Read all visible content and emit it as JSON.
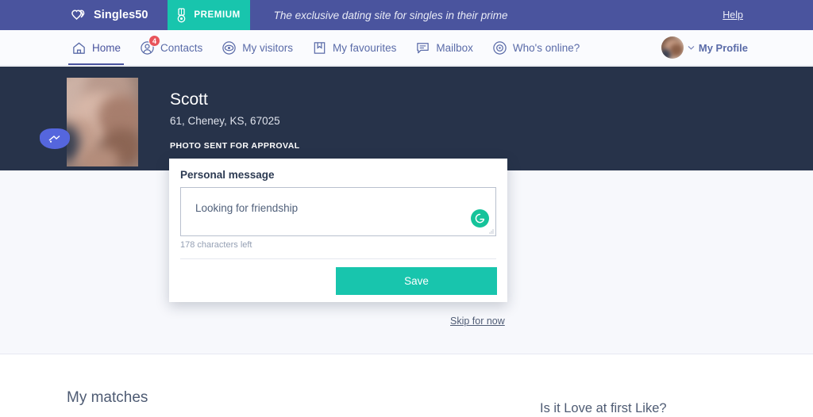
{
  "topbar": {
    "brand": "Singles50",
    "brand_logo_icon": "double-heart-icon",
    "premium_label": "PREMIUM",
    "premium_icon": "medal-icon",
    "tagline": "The exclusive dating site for singles in their prime",
    "help_label": "Help",
    "bg_color": "#4a549e",
    "premium_color": "#18c5ad"
  },
  "nav": {
    "items": [
      {
        "label": "Home",
        "icon": "home-icon",
        "active": true,
        "badge": ""
      },
      {
        "label": "Contacts",
        "icon": "person-circle-icon",
        "active": false,
        "badge": "4"
      },
      {
        "label": "My visitors",
        "icon": "eye-circle-icon",
        "active": false,
        "badge": ""
      },
      {
        "label": "My favourites",
        "icon": "bookmark-icon",
        "active": false,
        "badge": ""
      },
      {
        "label": "Mailbox",
        "icon": "speech-bubble-icon",
        "active": false,
        "badge": ""
      },
      {
        "label": "Who's online?",
        "icon": "target-circle-icon",
        "active": false,
        "badge": ""
      }
    ],
    "badge_color": "#e8545b",
    "profile": {
      "label": "My Profile",
      "avatar_icon": "user-avatar-photo",
      "chevron_icon": "chevron-down-icon"
    }
  },
  "hero": {
    "name": "Scott",
    "details": "61, Cheney, KS, 67025",
    "status": "PHOTO SENT FOR APPROVAL",
    "photo_icon": "profile-photo-thumbnail",
    "photo_badge_icon": "photo-pending-badge-icon",
    "bg_color": "#27334a"
  },
  "card": {
    "title": "Personal message",
    "message_value": "Looking for friendship",
    "message_placeholder": "Looking for friendship",
    "grammarly_icon": "grammarly-g-icon",
    "resize_icon": "resize-grip-icon",
    "characters_left": "178 characters left",
    "save_label": "Save",
    "save_color": "#18c5ad"
  },
  "skip": {
    "label": "Skip for now"
  },
  "lower": {
    "matches_title": "My matches",
    "love_title": "Is it Love at first Like?"
  }
}
